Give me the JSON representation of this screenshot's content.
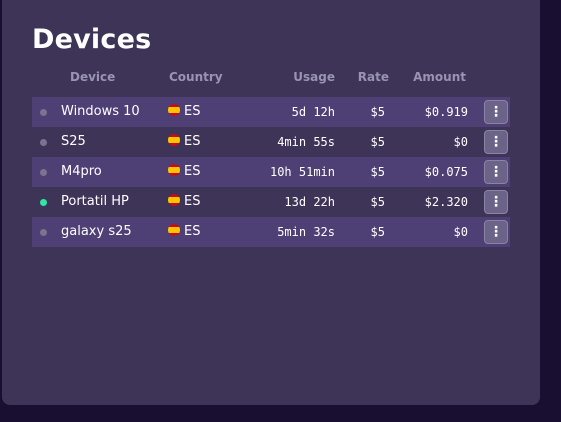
{
  "page": {
    "title": "Devices"
  },
  "table": {
    "headers": {
      "device": "Device",
      "country": "Country",
      "usage": "Usage",
      "rate": "Rate",
      "amount": "Amount"
    },
    "rows": [
      {
        "status": "offline",
        "device": "Windows 10",
        "country": "ES",
        "usage": "5d 12h",
        "rate": "$5",
        "amount": "$0.919"
      },
      {
        "status": "offline",
        "device": "S25",
        "country": "ES",
        "usage": "4min 55s",
        "rate": "$5",
        "amount": "$0"
      },
      {
        "status": "offline",
        "device": "M4pro",
        "country": "ES",
        "usage": "10h 51min",
        "rate": "$5",
        "amount": "$0.075"
      },
      {
        "status": "online",
        "device": "Portatil HP",
        "country": "ES",
        "usage": "13d 22h",
        "rate": "$5",
        "amount": "$2.320"
      },
      {
        "status": "offline",
        "device": "galaxy s25",
        "country": "ES",
        "usage": "5min 32s",
        "rate": "$5",
        "amount": "$0"
      }
    ],
    "row_menu_icon": "kebab-menu-icon",
    "flag_icon": "spain-flag-icon"
  },
  "colors": {
    "background": "#190f30",
    "panel": "#3d3457",
    "row_highlight": "#4e3f75",
    "status_online": "#2ee8a4",
    "status_offline": "#7a7490"
  }
}
